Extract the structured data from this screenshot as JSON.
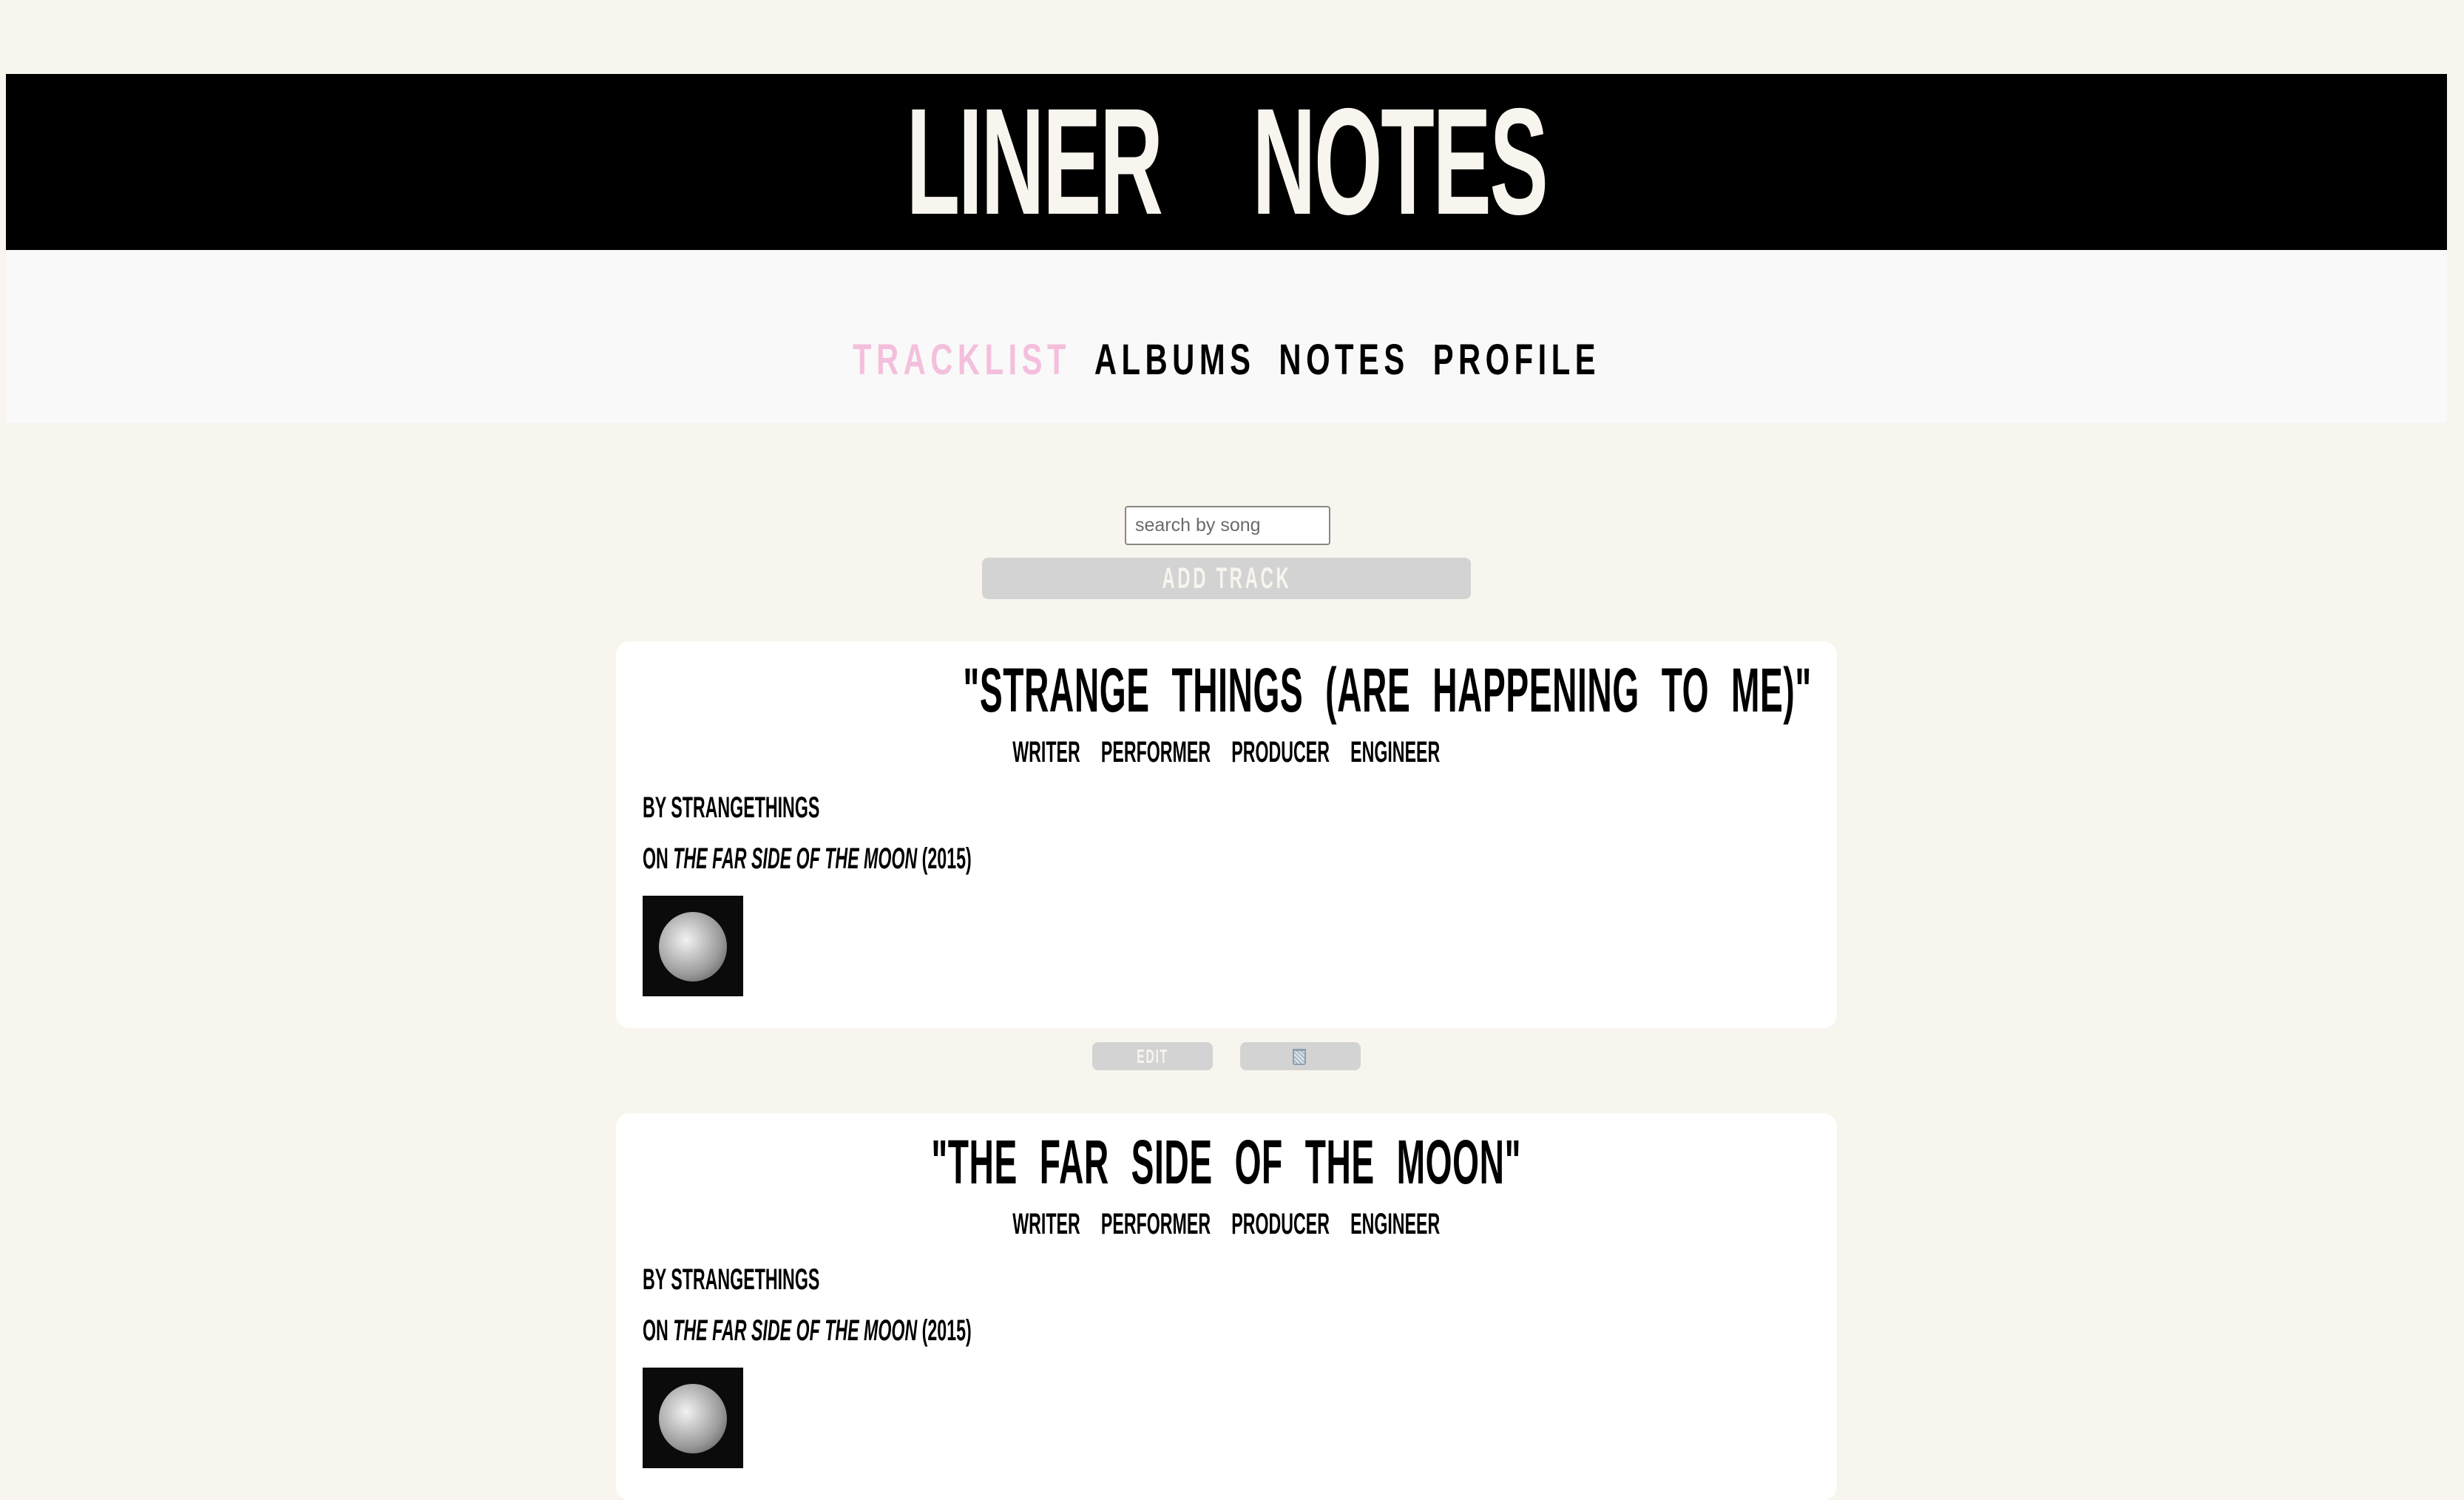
{
  "header": {
    "title": "LINER    NOTES"
  },
  "nav": {
    "items": [
      {
        "label": "TRACKLIST",
        "active": true
      },
      {
        "label": "ALBUMS",
        "active": false
      },
      {
        "label": "NOTES",
        "active": false
      },
      {
        "label": "PROFILE",
        "active": false
      }
    ]
  },
  "search": {
    "placeholder": "search by song",
    "value": ""
  },
  "add_track_label": "ADD TRACK",
  "colors": {
    "accent": "#f4bfdc",
    "background": "#f8f5ee",
    "button": "#d3d3d3"
  },
  "tracks": [
    {
      "title": "\"STRANGE THINGS (ARE HAPPENING TO ME)\"",
      "roles": [
        "WRITER",
        "PERFORMER",
        "PRODUCER",
        "ENGINEER"
      ],
      "by_prefix": "BY",
      "artist": "STRANGETHINGS",
      "on_prefix": "ON",
      "album": "THE FAR SIDE OF THE MOON",
      "year": "(2015)",
      "edit_label": "EDIT",
      "delete_icon": "trash-icon"
    },
    {
      "title": "\"THE FAR SIDE OF THE MOON\"",
      "roles": [
        "WRITER",
        "PERFORMER",
        "PRODUCER",
        "ENGINEER"
      ],
      "by_prefix": "BY",
      "artist": "STRANGETHINGS",
      "on_prefix": "ON",
      "album": "THE FAR SIDE OF THE MOON",
      "year": "(2015)"
    }
  ]
}
